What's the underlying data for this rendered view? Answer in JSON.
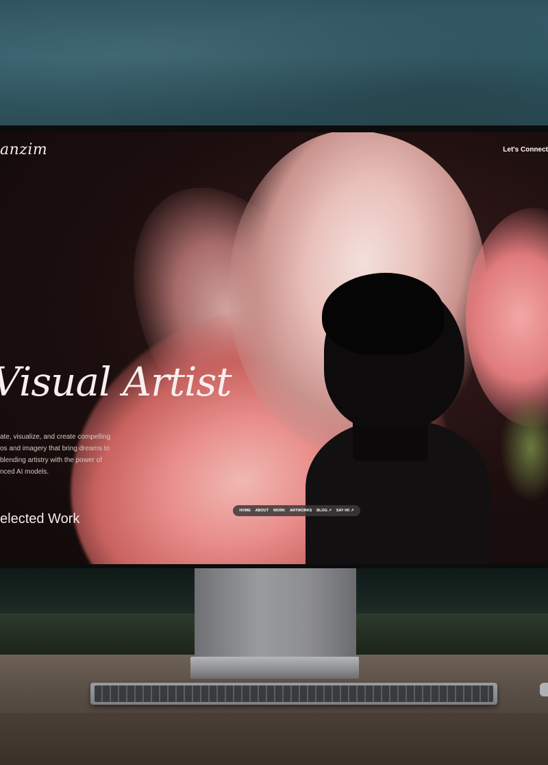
{
  "site": {
    "brand": "anzim",
    "cta_label": "Let's Connect"
  },
  "hero": {
    "title": "Visual Artist",
    "description_lines": [
      "ate, visualize, and create compelling",
      "os and imagery that bring dreams to",
      "blending artistry with the power of",
      "nced AI models."
    ]
  },
  "nav": {
    "items": [
      "HOME",
      "ABOUT",
      "WORK",
      "ARTWORKS",
      "BLOG ↗",
      "SAY HI! ↗"
    ]
  },
  "sections": {
    "selected_work": "elected Work"
  },
  "colors": {
    "screen_background": "#1c0e0e",
    "petal_pink": "#e98f8c",
    "text_light": "#f7efed",
    "nav_pill": "#3c3a3a"
  }
}
